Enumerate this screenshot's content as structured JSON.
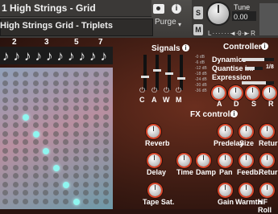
{
  "header": {
    "title": "1 High Strings - Grid",
    "subtitle": "High Strings Grid - Triplets",
    "purge_label": "Purge",
    "purge_arrow": "▾",
    "s_button": "S",
    "m_button": "M",
    "tune_label": "Tune",
    "tune_value": "0.00",
    "mini_left": "L·············R",
    "mini_right": "◄ 0 ►",
    "info": "i"
  },
  "step_numbers": [
    "2",
    "3",
    "5",
    "7"
  ],
  "note_glyphs": [
    "♪",
    "♪",
    "♪",
    "♪",
    "♪",
    "♪",
    "♪",
    "♪",
    "♪",
    "♪"
  ],
  "signals": {
    "title": "Signals",
    "db_scale": [
      "-0 dB",
      "-6 dB",
      "-12 dB",
      "-18 dB",
      "-24 dB",
      "-30 dB",
      "-36 dB"
    ],
    "labels": [
      "C",
      "A",
      "W",
      "M"
    ],
    "levels": [
      0.35,
      0.55,
      0.45,
      0.3
    ]
  },
  "controllers": {
    "title": "Controllers",
    "dynamics_label": "Dynamics",
    "quantise_label": "Quantise in.",
    "quantise_value": "1/8",
    "expression_label": "Expression",
    "dynamics_level": 0.7,
    "quantise_level": 0.55,
    "expression_level": 0.75,
    "adsr": [
      "A",
      "D",
      "S",
      "R"
    ]
  },
  "fx": {
    "title": "FX controls",
    "row1": [
      "Reverb",
      "Predelay",
      "Size",
      "Return"
    ],
    "row2": [
      "Delay",
      "Time",
      "Damp",
      "Pan",
      "Feedb.",
      "Return"
    ],
    "row3": [
      "Tape Sat.",
      "Gain",
      "Warmth",
      "HF Roll"
    ]
  }
}
